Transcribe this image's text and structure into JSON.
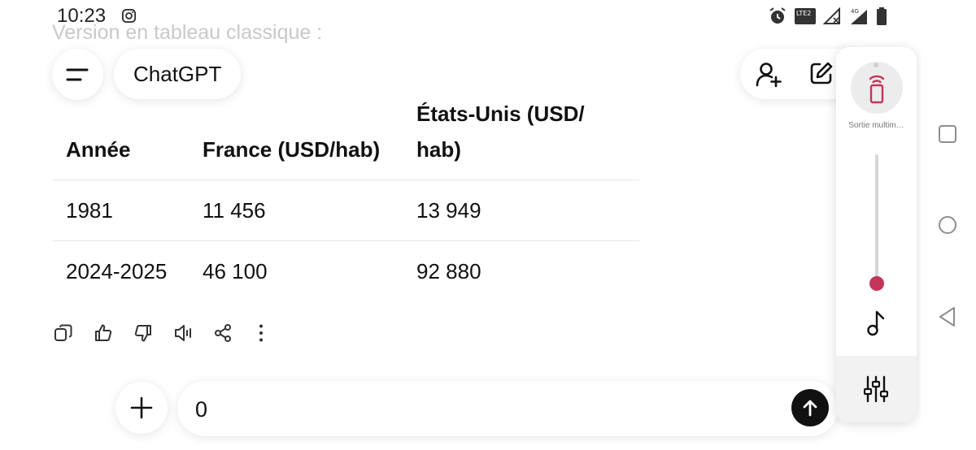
{
  "status_bar": {
    "time": "10:23",
    "icons": [
      "instagram-icon",
      "alarm-icon",
      "volte-icon",
      "no-signal-icon",
      "signal-4g-icon",
      "battery-icon"
    ],
    "lte_label": "LTE2",
    "net_label": "4G"
  },
  "chat": {
    "faded_text": "Version en tableau classique :",
    "title": "ChatGPT"
  },
  "table": {
    "headers": [
      "Année",
      "France (USD/hab)",
      "États-Unis (USD/ hab)"
    ],
    "rows": [
      [
        "1981",
        "11 456",
        "13 949"
      ],
      [
        "2024-2025",
        "46 100",
        "92 880"
      ]
    ]
  },
  "message_actions": [
    "copy-icon",
    "thumbs-up-icon",
    "thumbs-down-icon",
    "read-aloud-icon",
    "share-icon",
    "more-icon"
  ],
  "composer": {
    "value": "0"
  },
  "volume_panel": {
    "output_label": "Sortie multim…",
    "level": 0.05,
    "accent": "#c3355a"
  }
}
